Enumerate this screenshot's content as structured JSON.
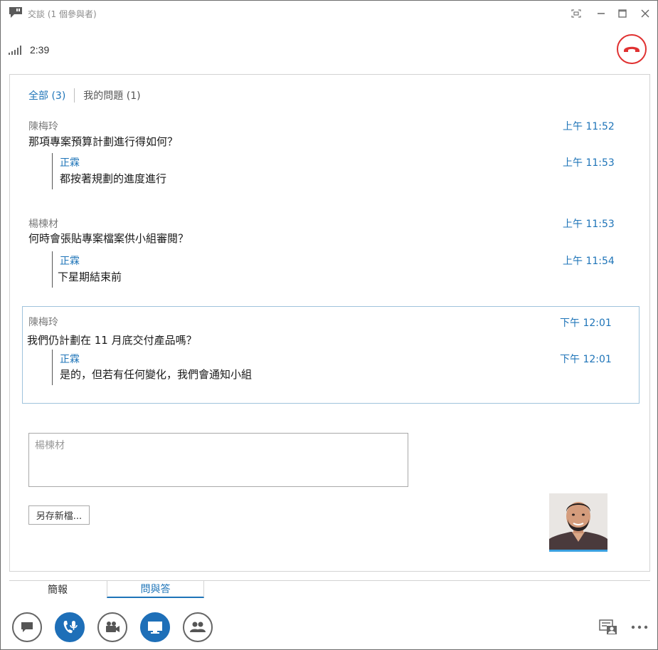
{
  "window": {
    "title": "交談 (1 個參與者)"
  },
  "status": {
    "elapsed": "2:39"
  },
  "filters": {
    "all_label": "全部 (3)",
    "mine_label": "我的問題 (1)"
  },
  "questions": [
    {
      "asker": "陳梅玲",
      "text": "那項專案預算計劃進行得如何？",
      "time": "上午 11:52",
      "responder": "正霖",
      "reply": "都按著規劃的進度進行",
      "reply_time": "上午 11:53"
    },
    {
      "asker": "楊楝材",
      "text": "何時會張貼專案檔案供小組審閱？",
      "time": "上午 11:53",
      "responder": "正霖",
      "reply": "下星期結束前",
      "reply_time": "上午 11:54"
    },
    {
      "asker": "陳梅玲",
      "text": "我們仍計劃在 11 月底交付產品嗎？",
      "time": "下午 12:01",
      "responder": "正霖",
      "reply": "是的，但若有任何變化，我們會通知小組",
      "reply_time": "下午 12:01"
    }
  ],
  "input": {
    "placeholder": "楊楝材"
  },
  "buttons": {
    "save_as": "另存新檔..."
  },
  "tabs": {
    "briefing": "簡報",
    "qa": "問與答"
  },
  "colors": {
    "accent": "#1e74b8",
    "hangup": "#e03131"
  }
}
